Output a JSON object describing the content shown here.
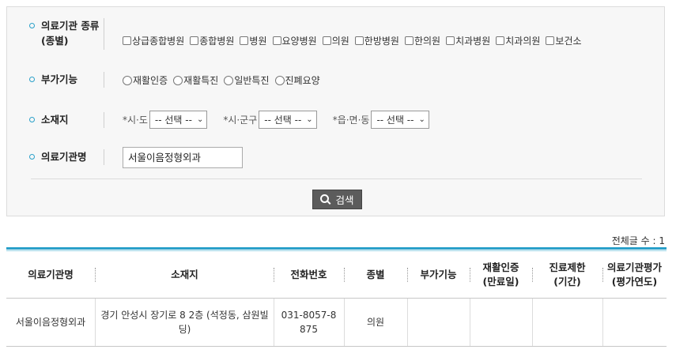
{
  "search": {
    "type_label": "의료기관 종류",
    "type_label_sub": "(종별)",
    "type_options": [
      "상급종합병원",
      "종합병원",
      "병원",
      "요양병원",
      "의원",
      "한방병원",
      "한의원",
      "치과병원",
      "치과의원",
      "보건소"
    ],
    "extra_label": "부가기능",
    "extra_options": [
      "재활인증",
      "재활특진",
      "일반특진",
      "진폐요양"
    ],
    "location_label": "소재지",
    "sido_label": "*시·도",
    "sigungu_label": "*시·군구",
    "eup_label": "*읍·면·동",
    "select_default": "-- 선택 --",
    "name_label": "의료기관명",
    "name_value": "서울이음정형외과",
    "search_button": "검색"
  },
  "results": {
    "total_text": "전체글 수 : 1",
    "headers": [
      "의료기관명",
      "소재지",
      "전화번호",
      "종별",
      "부가기능",
      "재활인증\n(만료일)",
      "진료제한\n(기간)",
      "의료기관평가\n(평가연도)"
    ],
    "rows": [
      [
        "서울이음정형외과",
        "경기 안성시 장기로 8 2층 (석정동, 삼원빌딩)",
        "031-8057-8875",
        "의원",
        "",
        "",
        "",
        ""
      ]
    ]
  },
  "colors": {
    "accent": "#2aa0c9",
    "button": "#5c5c5c"
  }
}
